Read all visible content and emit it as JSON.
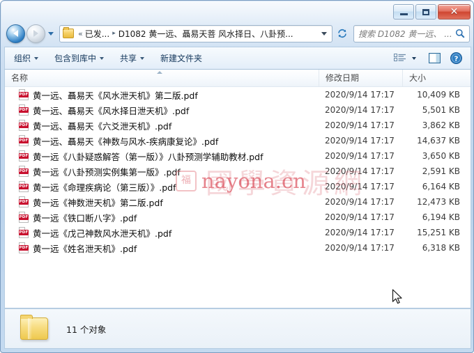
{
  "window": {
    "title": "",
    "controls": {
      "minimize_label": "–",
      "maximize_label": "□",
      "close_label": "✕"
    }
  },
  "navbar": {
    "back_label": "←",
    "forward_label": "→",
    "history_label": "▾",
    "breadcrumb": {
      "overflow_label": "«",
      "root_label": "已发...",
      "separator": "▸",
      "current_label": "D1082 黄一远、聶易天菩 风水择日、八卦预...",
      "dropdown_label": "▾"
    },
    "refresh_icon": "refresh-icon",
    "search": {
      "placeholder": "搜索 D1082 黄一远、 ...",
      "icon": "search-icon"
    }
  },
  "toolbar": {
    "organize_label": "组织",
    "include_in_library_label": "包含到库中",
    "share_label": "共享",
    "new_folder_label": "新建文件夹",
    "view_icon": "view-options-icon",
    "view_caret_label": "▾",
    "preview_pane_icon": "preview-pane-icon",
    "help_icon": "help-icon",
    "help_label": "?"
  },
  "columns": {
    "name": "名称",
    "date_modified": "修改日期",
    "size": "大小"
  },
  "files": [
    {
      "icon": "pdf-icon",
      "badge": "PDF",
      "name": "黄一远、聶易天《风水泄天机》第二版.pdf",
      "date": "2020/9/14 17:17",
      "size": "10,409 KB"
    },
    {
      "icon": "pdf-icon",
      "badge": "PDF",
      "name": "黄一远、聶易天《风水择日泄天机》.pdf",
      "date": "2020/9/14 17:17",
      "size": "5,501 KB"
    },
    {
      "icon": "pdf-icon",
      "badge": "PDF",
      "name": "黄一远、聶易天《六爻泄天机》.pdf",
      "date": "2020/9/14 17:17",
      "size": "3,862 KB"
    },
    {
      "icon": "pdf-icon",
      "badge": "PDF",
      "name": "黄一远、聶易天《神数与风水-疾病康复论》.pdf",
      "date": "2020/9/14 17:17",
      "size": "14,637 KB"
    },
    {
      "icon": "pdf-icon",
      "badge": "PDF",
      "name": "黄一远《八卦疑惑解答（第一版）》八卦预测学辅助教材.pdf",
      "date": "2020/9/14 17:17",
      "size": "3,650 KB"
    },
    {
      "icon": "pdf-icon",
      "badge": "PDF",
      "name": "黄一远《八卦预测实例集第一版》.pdf",
      "date": "2020/9/14 17:17",
      "size": "2,591 KB"
    },
    {
      "icon": "pdf-icon",
      "badge": "PDF",
      "name": "黄一远《命理疾病论（第三版）》.pdf",
      "date": "2020/9/14 17:17",
      "size": "6,164 KB"
    },
    {
      "icon": "pdf-icon",
      "badge": "PDF",
      "name": "黄一远《神数泄天机》第二版.pdf",
      "date": "2020/9/14 17:17",
      "size": "12,473 KB"
    },
    {
      "icon": "pdf-icon",
      "badge": "PDF",
      "name": "黄一远《铁口断八字》.pdf",
      "date": "2020/9/14 17:17",
      "size": "6,194 KB"
    },
    {
      "icon": "pdf-icon",
      "badge": "PDF",
      "name": "黄一远《戊己神数风水泄天机》.pdf",
      "date": "2020/9/14 17:17",
      "size": "15,251 KB"
    },
    {
      "icon": "pdf-icon",
      "badge": "PDF",
      "name": "黄一远《姓名泄天机》.pdf",
      "date": "2020/9/14 17:17",
      "size": "6,318 KB"
    }
  ],
  "watermark": {
    "latin": "nayona.cn",
    "cjk": "國學資源網",
    "seal": "福"
  },
  "statusbar": {
    "item_count": "11 个对象",
    "folder_icon": "folder-icon"
  },
  "colors": {
    "accent": "#2f7fc4",
    "pdf_red": "#c8102e",
    "close_red": "#cf4631",
    "watermark_red": "#d73746",
    "frame_blue": "#bcd4ec"
  }
}
